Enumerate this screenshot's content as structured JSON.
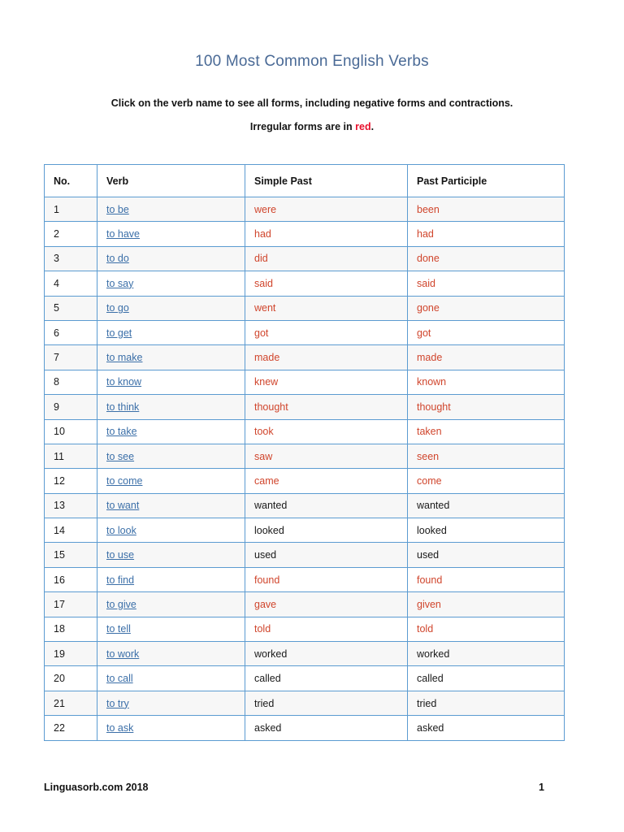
{
  "document": {
    "title": "100 Most Common English Verbs",
    "intro_line_1": "Click on the verb name to see all forms, including negative forms and contractions.",
    "intro_line_2_prefix": "Irregular forms are in ",
    "intro_line_2_highlight": "red",
    "intro_line_2_suffix": "."
  },
  "colors": {
    "title": "#4a6a96",
    "link": "#3b6fa8",
    "irregular": "#d0452c",
    "highlight_red": "#e8112d",
    "table_border": "#5b9bd1",
    "row_shaded": "#f7f7f7"
  },
  "table": {
    "columns": [
      "No.",
      "Verb",
      "Simple Past",
      "Past Participle"
    ],
    "rows": [
      {
        "no": "1",
        "verb": "to be",
        "simple_past": "were",
        "past_participle": "been",
        "irregular": true
      },
      {
        "no": "2",
        "verb": "to have",
        "simple_past": "had",
        "past_participle": "had",
        "irregular": true
      },
      {
        "no": "3",
        "verb": "to do",
        "simple_past": "did",
        "past_participle": "done",
        "irregular": true
      },
      {
        "no": "4",
        "verb": "to say",
        "simple_past": "said",
        "past_participle": "said",
        "irregular": true
      },
      {
        "no": "5",
        "verb": "to go",
        "simple_past": "went",
        "past_participle": "gone",
        "irregular": true
      },
      {
        "no": "6",
        "verb": "to get",
        "simple_past": "got",
        "past_participle": "got",
        "irregular": true
      },
      {
        "no": "7",
        "verb": "to make",
        "simple_past": "made",
        "past_participle": "made",
        "irregular": true
      },
      {
        "no": "8",
        "verb": "to know",
        "simple_past": "knew",
        "past_participle": "known",
        "irregular": true
      },
      {
        "no": "9",
        "verb": "to think",
        "simple_past": "thought",
        "past_participle": "thought",
        "irregular": true
      },
      {
        "no": "10",
        "verb": "to take",
        "simple_past": "took",
        "past_participle": "taken",
        "irregular": true
      },
      {
        "no": "11",
        "verb": "to see",
        "simple_past": "saw",
        "past_participle": "seen",
        "irregular": true
      },
      {
        "no": "12",
        "verb": "to come",
        "simple_past": "came",
        "past_participle": "come",
        "irregular": true
      },
      {
        "no": "13",
        "verb": "to want",
        "simple_past": "wanted",
        "past_participle": "wanted",
        "irregular": false
      },
      {
        "no": "14",
        "verb": "to look",
        "simple_past": "looked",
        "past_participle": "looked",
        "irregular": false
      },
      {
        "no": "15",
        "verb": "to use",
        "simple_past": "used",
        "past_participle": "used",
        "irregular": false
      },
      {
        "no": "16",
        "verb": "to find",
        "simple_past": "found",
        "past_participle": "found",
        "irregular": true
      },
      {
        "no": "17",
        "verb": "to give",
        "simple_past": "gave",
        "past_participle": "given",
        "irregular": true
      },
      {
        "no": "18",
        "verb": "to tell",
        "simple_past": "told",
        "past_participle": "told",
        "irregular": true
      },
      {
        "no": "19",
        "verb": "to work",
        "simple_past": "worked",
        "past_participle": "worked",
        "irregular": false
      },
      {
        "no": "20",
        "verb": "to call",
        "simple_past": "called",
        "past_participle": "called",
        "irregular": false
      },
      {
        "no": "21",
        "verb": "to try",
        "simple_past": "tried",
        "past_participle": "tried",
        "irregular": false
      },
      {
        "no": "22",
        "verb": "to ask",
        "simple_past": "asked",
        "past_participle": "asked",
        "irregular": false
      }
    ]
  },
  "footer": {
    "left": "Linguasorb.com 2018",
    "page_number": "1"
  }
}
